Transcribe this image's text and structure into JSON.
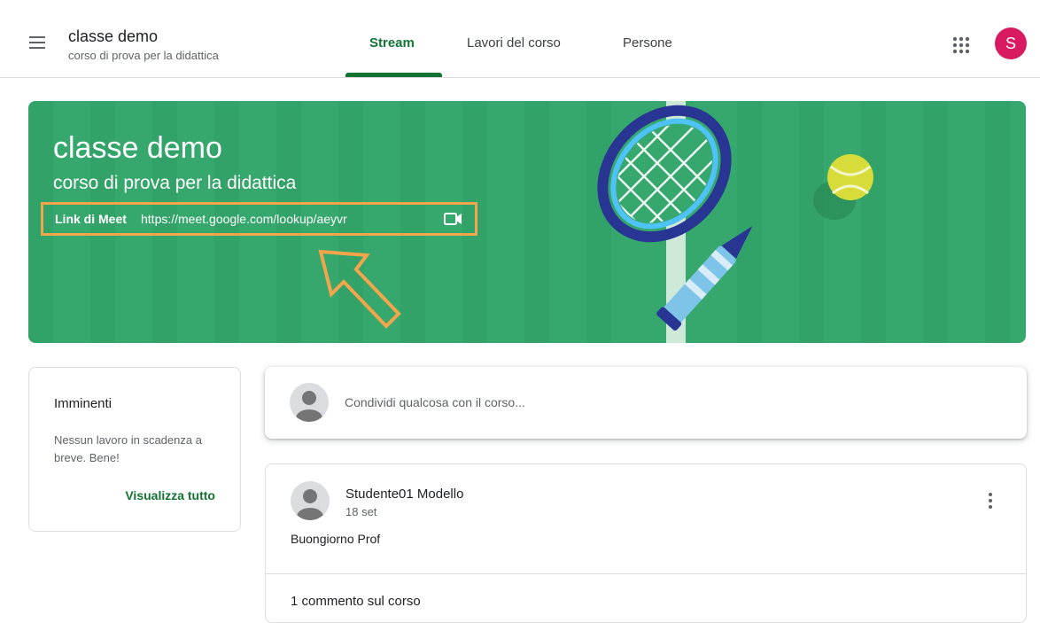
{
  "header": {
    "class_title": "classe demo",
    "class_subtitle": "corso di prova per la didattica",
    "tabs": [
      {
        "label": "Stream",
        "active": true
      },
      {
        "label": "Lavori del corso",
        "active": false
      },
      {
        "label": "Persone",
        "active": false
      }
    ],
    "account_initial": "S",
    "accent_color": "#137333",
    "avatar_color": "#d81b60"
  },
  "banner": {
    "title": "classe demo",
    "subtitle": "corso di prova per la didattica",
    "meet_label": "Link di Meet",
    "meet_link": "https://meet.google.com/lookup/aeyvr",
    "background_color": "#36a86d",
    "highlight_color": "#f2a54a"
  },
  "upcoming": {
    "title": "Imminenti",
    "text": "Nessun lavoro in scadenza a breve. Bene!",
    "view_all": "Visualizza tutto"
  },
  "share": {
    "placeholder": "Condividi qualcosa con il corso..."
  },
  "post": {
    "author": "Studente01 Modello",
    "date": "18 set",
    "body": "Buongiorno Prof",
    "comments_label": "1 commento sul corso"
  },
  "icons": {
    "menu": "hamburger-menu-icon",
    "apps": "google-apps-grid-icon",
    "meet": "video-camera-icon",
    "more": "more-vert-icon"
  }
}
